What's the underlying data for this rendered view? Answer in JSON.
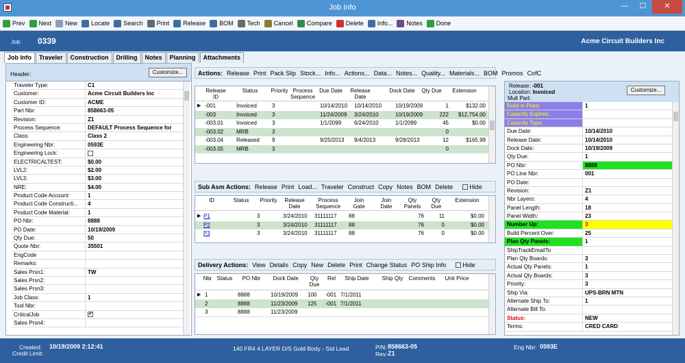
{
  "window": {
    "title": "Job Info"
  },
  "toolbar": [
    {
      "label": "Prev",
      "icon": "prev-icon",
      "color": "#2e9e3e"
    },
    {
      "label": "Next",
      "icon": "next-icon",
      "color": "#2e9e3e"
    },
    {
      "label": "New",
      "icon": "new-document-icon",
      "color": "#8aa0b8"
    },
    {
      "label": "Locate",
      "icon": "locate-icon",
      "color": "#3a6ea5"
    },
    {
      "label": "Search",
      "icon": "search-icon",
      "color": "#3a6ea5"
    },
    {
      "label": "Print",
      "icon": "printer-icon",
      "color": "#5a6a7a"
    },
    {
      "label": "Release",
      "icon": "release-icon",
      "color": "#3a6ea5"
    },
    {
      "label": "BOM",
      "icon": "bom-icon",
      "color": "#3a6ea5"
    },
    {
      "label": "Tech",
      "icon": "tech-icon",
      "color": "#6a6a6a"
    },
    {
      "label": "Cancel",
      "icon": "cancel-icon",
      "color": "#8a7a3a"
    },
    {
      "label": "Compare",
      "icon": "compare-icon",
      "color": "#2e8e4e"
    },
    {
      "label": "Delete",
      "icon": "delete-icon",
      "color": "#d0302a"
    },
    {
      "label": "Info...",
      "icon": "info-icon",
      "color": "#3a6ea5"
    },
    {
      "label": "Notes",
      "icon": "notes-icon",
      "color": "#6a4a8a"
    },
    {
      "label": "Done",
      "icon": "checkmark-icon",
      "color": "#2e9e3e"
    }
  ],
  "job": {
    "label": "Job:",
    "number": "0339",
    "company": "Acme Circuit Builders Inc"
  },
  "tabs": [
    "Job Info",
    "Traveler",
    "Construction",
    "Drilling",
    "Notes",
    "Planning",
    "Attachments"
  ],
  "left_panel": {
    "header": "Header:",
    "customize": "Customize...",
    "fields": [
      {
        "k": "Traveler Type:",
        "v": "C1"
      },
      {
        "k": "Customer:",
        "v": "Acme Circuit Builders Inc"
      },
      {
        "k": "Customer ID:",
        "v": "ACME"
      },
      {
        "k": "Part Nbr:",
        "v": "858663-05"
      },
      {
        "k": "Revision:",
        "v": "Z1"
      },
      {
        "k": "Process Sequence:",
        "v": "DEFAULT Process Sequence for"
      },
      {
        "k": "Class:",
        "v": "Class 2"
      },
      {
        "k": "Engineering Nbr:",
        "v": "0593E"
      },
      {
        "k": "Engineering Lock:",
        "v": "",
        "checkbox": false
      },
      {
        "k": "ELECTRICALTEST:",
        "v": "$0.00"
      },
      {
        "k": "LVL2:",
        "v": "$2.00"
      },
      {
        "k": "LVL3:",
        "v": "$3.00"
      },
      {
        "k": "NRE:",
        "v": "$4.00"
      },
      {
        "k": "Product Code Account:",
        "v": "1"
      },
      {
        "k": "Product Code Constructi...",
        "v": "4"
      },
      {
        "k": "Product Code Material:",
        "v": "1"
      },
      {
        "k": "PO Nbr:",
        "v": "8888"
      },
      {
        "k": "PO Date:",
        "v": "10/19/2009"
      },
      {
        "k": "Qty Due:",
        "v": "50"
      },
      {
        "k": "Quote Nbr:",
        "v": "35501"
      },
      {
        "k": "EngCode",
        "v": ""
      },
      {
        "k": "Remarks:",
        "v": ""
      },
      {
        "k": "Sales Prsn1:",
        "v": "TW"
      },
      {
        "k": "Sales Prsn2:",
        "v": ""
      },
      {
        "k": "Sales Prsn3:",
        "v": ""
      },
      {
        "k": "Job Class:",
        "v": "1"
      },
      {
        "k": "Tool Nbr:",
        "v": ""
      },
      {
        "k": "CriticalJob",
        "v": "",
        "checkbox": true
      },
      {
        "k": "Sales Prsn4:",
        "v": ""
      }
    ]
  },
  "actions": {
    "label": "Actions:",
    "items": [
      "Release",
      "Print",
      "Pack Slip",
      "Stock...",
      "Info...",
      "Actions...",
      "Data...",
      "Notes...",
      "Quality...",
      "Materials...",
      "BOM",
      "Promos",
      "CofC"
    ]
  },
  "releases": {
    "headers": [
      "Release ID",
      "Status",
      "Priority",
      "Process Sequence",
      "Due Date",
      "Release Date",
      "Dock Date",
      "Qty Due",
      "Extension"
    ],
    "rows": [
      {
        "id": "-001",
        "status": "Invoiced",
        "priority": "3",
        "seq": "",
        "due": "10/14/2010",
        "release": "10/14/2010",
        "dock": "10/19/2009",
        "qty": "1",
        "ext": "$132.00",
        "hl": false,
        "current": true
      },
      {
        "id": "-003",
        "status": "Invoiced",
        "priority": "3",
        "seq": "",
        "due": "11/24/2009",
        "release": "3/24/2010",
        "dock": "10/19/2009",
        "qty": "222",
        "ext": "$12,754.00",
        "hl": true,
        "current": false
      },
      {
        "id": "-003.01",
        "status": "Invoiced",
        "priority": "3",
        "seq": "",
        "due": "1/1/2099",
        "release": "6/24/2010",
        "dock": "1/1/2099",
        "qty": "45",
        "ext": "$0.00",
        "hl": false,
        "current": false
      },
      {
        "id": "-003.02",
        "status": "MRB",
        "priority": "3",
        "seq": "",
        "due": "",
        "release": "",
        "dock": "",
        "qty": "0",
        "ext": "",
        "hl": true,
        "current": false
      },
      {
        "id": "-003.04",
        "status": "Released",
        "priority": "9",
        "seq": "",
        "due": "9/25/2013",
        "release": "9/4/2013",
        "dock": "9/28/2013",
        "qty": "12",
        "ext": "$165.99",
        "hl": false,
        "current": false
      },
      {
        "id": "-003.05",
        "status": "MRB",
        "priority": "3",
        "seq": "",
        "due": "",
        "release": "",
        "dock": "",
        "qty": "0",
        "ext": "",
        "hl": true,
        "current": false
      }
    ]
  },
  "sub_asm": {
    "label": "Sub Asm Actions:",
    "items": [
      "Release",
      "Print",
      "Load...",
      "Traveler",
      "Construct",
      "Copy",
      "Notes",
      "BOM",
      "Delete"
    ],
    "hide": "Hide",
    "headers": [
      "ID",
      "Status",
      "Priority",
      "Release Date",
      "Process Sequence",
      "Join Gate",
      "Join Date",
      "Qty Panels",
      "Qty Due",
      "Extension"
    ],
    "rows": [
      {
        "id": "P1",
        "status": "",
        "priority": "3",
        "release": "3/24/2010",
        "seq": "31111117",
        "gate": "88",
        "join": "",
        "panels": "76",
        "qty": "11",
        "ext": "$0.00",
        "hl": false,
        "current": true
      },
      {
        "id": "P2",
        "status": "",
        "priority": "3",
        "release": "3/24/2010",
        "seq": "31111117",
        "gate": "88",
        "join": "",
        "panels": "76",
        "qty": "0",
        "ext": "$0.00",
        "hl": true,
        "current": false
      },
      {
        "id": "P3",
        "status": "",
        "priority": "3",
        "release": "3/24/2010",
        "seq": "31111117",
        "gate": "88",
        "join": "",
        "panels": "76",
        "qty": "0",
        "ext": "$0.00",
        "hl": false,
        "current": false
      }
    ]
  },
  "delivery": {
    "label": "Delivery Actions:",
    "items": [
      "View",
      "Details",
      "Copy",
      "New",
      "Delete",
      "Print",
      "Change Status",
      "PO Ship Info"
    ],
    "hide": "Hide",
    "headers": [
      "Nbr",
      "Status",
      "PO Nbr",
      "Dock Date",
      "Qty Due",
      "Rel",
      "Ship Date",
      "Ship Qty",
      "Comments",
      "Unit Price"
    ],
    "rows": [
      {
        "nbr": "1",
        "status": "",
        "po": "8888",
        "dock": "10/19/2009",
        "qty": "100",
        "rel": "-001",
        "ship": "7/1/2011",
        "shipqty": "",
        "comments": "",
        "price": "",
        "hl": false,
        "current": true
      },
      {
        "nbr": "2",
        "status": "",
        "po": "8888",
        "dock": "11/23/2009",
        "qty": "125",
        "rel": "-001",
        "ship": "7/1/2011",
        "shipqty": "",
        "comments": "",
        "price": "",
        "hl": true,
        "current": false
      },
      {
        "nbr": "3",
        "status": "",
        "po": "8888",
        "dock": "11/23/2009",
        "qty": "",
        "rel": "",
        "ship": "",
        "shipqty": "",
        "comments": "",
        "price": "",
        "hl": false,
        "current": false
      }
    ]
  },
  "right_panel": {
    "release_label": "Release:",
    "release": "-001",
    "location_label": "Location:",
    "location": "Invoiced",
    "multpart": "Mult Part:",
    "customize": "Customize...",
    "fields": [
      {
        "k": "Build in Plant:",
        "v": "1",
        "kstyle": "purple"
      },
      {
        "k": "Capacity Expires:",
        "v": "",
        "kstyle": "purple"
      },
      {
        "k": "Capacity Type:",
        "v": "",
        "kstyle": "purple"
      },
      {
        "k": "Due Date:",
        "v": "10/14/2010"
      },
      {
        "k": "Release Date:",
        "v": "10/14/2010"
      },
      {
        "k": "Dock Date:",
        "v": "10/19/2009"
      },
      {
        "k": "Qty Due:",
        "v": "1"
      },
      {
        "k": "PO Nbr:",
        "v": "8888",
        "vstyle": "green"
      },
      {
        "k": "PO Line Nbr:",
        "v": "001"
      },
      {
        "k": "PO Date:",
        "v": ""
      },
      {
        "k": "Revision:",
        "v": "Z1"
      },
      {
        "k": "Nbr Layers:",
        "v": "4"
      },
      {
        "k": "Panel Length:",
        "v": "18"
      },
      {
        "k": "Panel Width:",
        "v": "23"
      },
      {
        "k": "Number Up:",
        "v": "3",
        "kstyle": "green",
        "vstyle": "yellow"
      },
      {
        "k": "Build Percent Over:",
        "v": "25"
      },
      {
        "k": "Plan Qty Panels:",
        "v": "1",
        "kstyle": "green"
      },
      {
        "k": "ShipTrackEmailTo",
        "v": ""
      },
      {
        "k": "Plan Qty Boards:",
        "v": "3"
      },
      {
        "k": "Actual Qty Panels:",
        "v": "1"
      },
      {
        "k": "Actual Qty Boards:",
        "v": "3"
      },
      {
        "k": "Priority:",
        "v": "3"
      },
      {
        "k": "Ship Via:",
        "v": "UPS-BRN MTN"
      },
      {
        "k": "Alternate Ship To:",
        "v": "1"
      },
      {
        "k": "Alternate Bill To:",
        "v": ""
      },
      {
        "k": "Status:",
        "v": "NEW",
        "kstyle": "red"
      },
      {
        "k": "Terms:",
        "v": "CRED CARD"
      }
    ]
  },
  "status_bar": {
    "created_label": "Created:",
    "created": "10/19/2009  2:12:41",
    "credit_label": "Credit Limit:",
    "description": "140 FR4 4 LAYER D/S Gold Body - Std Lead",
    "pn_label": "P/N:",
    "pn": "858663-05",
    "rev_label": "Rev:",
    "rev": "Z1",
    "eng_label": "Eng Nbr:",
    "eng": "0593E"
  },
  "colors": {
    "title_bar": "#4f95d3",
    "job_bar": "#2e5f9e",
    "row_highlight": "#cde3cd",
    "purple": "#8b7ee8",
    "green": "#22e022",
    "yellow": "#ffff00",
    "red": "#dd0000"
  }
}
